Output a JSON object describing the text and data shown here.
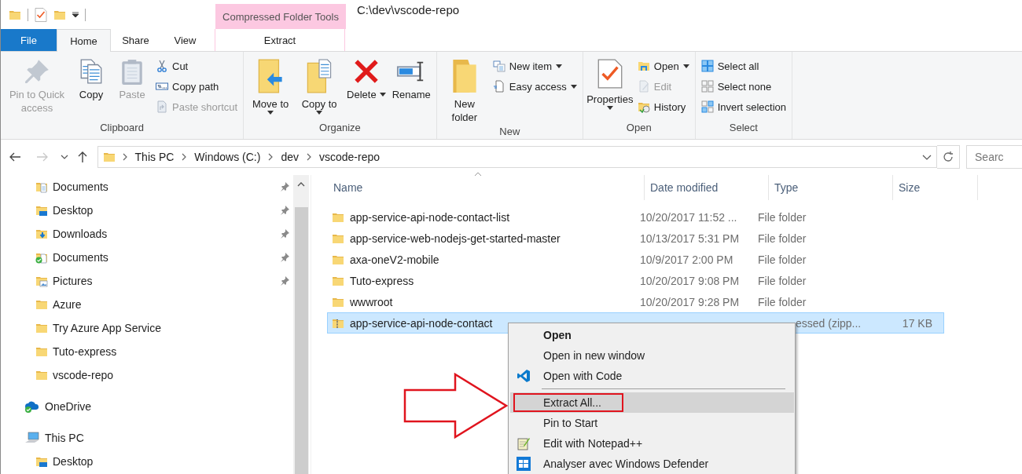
{
  "contextual_tab": {
    "title": "Compressed Folder Tools"
  },
  "window_title": "C:\\dev\\vscode-repo",
  "tabs": [
    {
      "label": "File",
      "kind": "file",
      "selected": false
    },
    {
      "label": "Home",
      "kind": "tab",
      "selected": true
    },
    {
      "label": "Share",
      "kind": "tab",
      "selected": false
    },
    {
      "label": "View",
      "kind": "tab",
      "selected": false
    },
    {
      "label": "Extract",
      "kind": "contextual",
      "selected": false
    }
  ],
  "ribbon": {
    "groups": [
      {
        "label": "Clipboard",
        "columns": [
          {
            "kind": "pushpin",
            "label": "Pin to Quick access",
            "disabled": true,
            "dropdown": false
          },
          {
            "kind": "pages",
            "label": "Copy",
            "disabled": false,
            "dropdown": false
          },
          {
            "kind": "clipboard",
            "label": "Paste",
            "disabled": true,
            "dropdown": false
          },
          {
            "kind": "stack",
            "items": [
              {
                "label": "Cut",
                "kind": "scissors",
                "disabled": false,
                "dropdown": false
              },
              {
                "label": "Copy path",
                "kind": "text-field",
                "disabled": false,
                "dropdown": false
              },
              {
                "label": "Paste shortcut",
                "kind": "shortcut",
                "disabled": true,
                "dropdown": false
              }
            ]
          }
        ]
      },
      {
        "label": "Organize",
        "columns": [
          {
            "kind": "folder-arrow",
            "label": "Move to",
            "disabled": false,
            "dropdown": true
          },
          {
            "kind": "folder-pages",
            "label": "Copy to",
            "disabled": false,
            "dropdown": true
          },
          {
            "kind": "cross",
            "label": "Delete",
            "disabled": false,
            "dropdown": true
          },
          {
            "kind": "rename",
            "label": "Rename",
            "disabled": false,
            "dropdown": false
          }
        ]
      },
      {
        "label": "New",
        "columns": [
          {
            "kind": "folder",
            "label": "New folder",
            "disabled": false,
            "dropdown": false
          },
          {
            "kind": "stack",
            "items": [
              {
                "label": "New item",
                "kind": "new-item",
                "disabled": false,
                "dropdown": true
              },
              {
                "label": "Easy access",
                "kind": "page",
                "disabled": false,
                "dropdown": true
              }
            ]
          }
        ]
      },
      {
        "label": "Open",
        "columns": [
          {
            "kind": "checkmark-page",
            "label": "Properties",
            "disabled": false,
            "dropdown": true
          },
          {
            "kind": "stack",
            "items": [
              {
                "label": "Open",
                "kind": "window-folder",
                "disabled": false,
                "dropdown": true
              },
              {
                "label": "Edit",
                "kind": "pencil-page",
                "disabled": true,
                "dropdown": false
              },
              {
                "label": "History",
                "kind": "clock-folder",
                "disabled": false,
                "dropdown": false
              }
            ]
          }
        ]
      },
      {
        "label": "Select",
        "columns": [
          {
            "kind": "stack",
            "items": [
              {
                "label": "Select all",
                "kind": "grid",
                "disabled": false,
                "dropdown": false
              },
              {
                "label": "Select none",
                "kind": "empty-grid",
                "disabled": false,
                "dropdown": false
              },
              {
                "label": "Invert selection",
                "kind": "partial-grid",
                "disabled": false,
                "dropdown": false
              }
            ]
          }
        ]
      }
    ]
  },
  "address_bar": {
    "segments": [
      "This PC",
      "Windows (C:)",
      "dev",
      "vscode-repo"
    ],
    "search": {
      "placeholder": "Searc"
    }
  },
  "sidebar": {
    "quick_access_items": [
      {
        "label": "Documents",
        "kind": "documents",
        "pinned": true
      },
      {
        "label": "Desktop",
        "kind": "desktop",
        "pinned": true
      },
      {
        "label": "Downloads",
        "kind": "downloads",
        "pinned": true
      },
      {
        "label": "Documents",
        "kind": "synced-documents",
        "pinned": true
      },
      {
        "label": "Pictures",
        "kind": "pictures",
        "pinned": true
      },
      {
        "label": "Azure",
        "kind": "folder",
        "pinned": false
      },
      {
        "label": "Try Azure App Service",
        "kind": "folder",
        "pinned": false
      },
      {
        "label": "Tuto-express",
        "kind": "folder",
        "pinned": false
      },
      {
        "label": "vscode-repo",
        "kind": "folder",
        "pinned": false
      }
    ],
    "roots": [
      {
        "label": "OneDrive",
        "kind": "cloud"
      },
      {
        "label": "This PC",
        "kind": "computer",
        "children": [
          {
            "label": "Desktop",
            "kind": "desktop"
          }
        ]
      }
    ]
  },
  "file_list": {
    "columns": [
      "Name",
      "Date modified",
      "Type",
      "Size"
    ],
    "rows": [
      {
        "name": "app-service-api-node-contact-list",
        "date": "10/20/2017 11:52 ...",
        "type": "File folder",
        "kind": "folder",
        "selected": false
      },
      {
        "name": "app-service-web-nodejs-get-started-master",
        "date": "10/13/2017 5:31 PM",
        "type": "File folder",
        "kind": "folder",
        "selected": false
      },
      {
        "name": "axa-oneV2-mobile",
        "date": "10/9/2017 2:00 PM",
        "type": "File folder",
        "kind": "folder",
        "selected": false
      },
      {
        "name": "Tuto-express",
        "date": "10/20/2017 9:08 PM",
        "type": "File folder",
        "kind": "folder",
        "selected": false
      },
      {
        "name": "wwwroot",
        "date": "10/20/2017 9:28 PM",
        "type": "File folder",
        "kind": "folder",
        "selected": false
      },
      {
        "name": "app-service-api-node-contact",
        "type": "essed (zipp...",
        "size": "17 KB",
        "kind": "zip",
        "selected": true
      }
    ]
  },
  "context_menu": {
    "items": [
      {
        "kind": "plain",
        "label": "Open",
        "bold": true,
        "selected": false,
        "annotated": false
      },
      {
        "kind": "plain",
        "label": "Open in new window",
        "bold": false,
        "selected": false,
        "annotated": false
      },
      {
        "kind": "code",
        "label": "Open with Code",
        "bold": false,
        "selected": false,
        "annotated": false
      },
      {
        "kind": "separator"
      },
      {
        "kind": "plain",
        "label": "Extract All...",
        "bold": false,
        "selected": true,
        "annotated": true
      },
      {
        "kind": "plain",
        "label": "Pin to Start",
        "bold": false,
        "selected": false,
        "annotated": false
      },
      {
        "kind": "notepad",
        "label": "Edit with Notepad++",
        "bold": false,
        "selected": false,
        "annotated": false
      },
      {
        "kind": "shield",
        "label": "Analyser avec Windows Defender",
        "bold": false,
        "selected": false,
        "annotated": false
      }
    ]
  }
}
